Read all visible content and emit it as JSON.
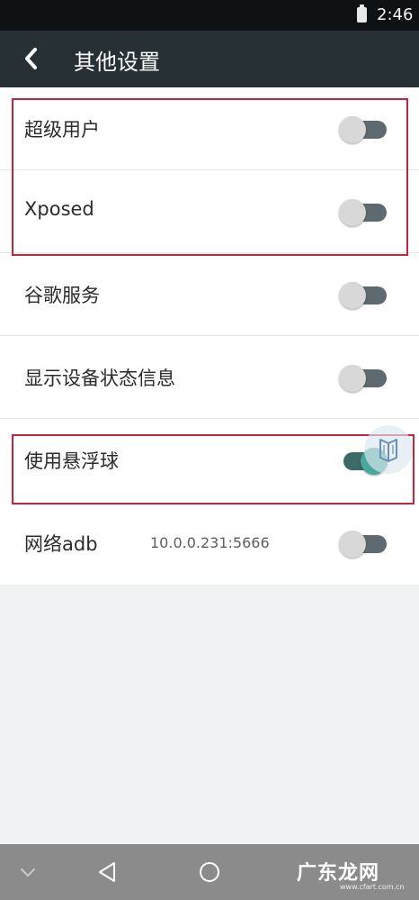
{
  "status_bar": {
    "time": "2:46"
  },
  "app_bar": {
    "title": "其他设置"
  },
  "settings": [
    {
      "label": "超级用户",
      "enabled": false
    },
    {
      "label": "Xposed",
      "enabled": false
    },
    {
      "label": "谷歌服务",
      "enabled": false
    },
    {
      "label": "显示设备状态信息",
      "enabled": false
    },
    {
      "label": "使用悬浮球",
      "enabled": true
    },
    {
      "label": "网络adb",
      "value": "10.0.0.231:5666",
      "enabled": false
    }
  ],
  "highlight_color": "#c6243b",
  "toggle_on_color": "#4aa79b",
  "watermark": {
    "text": "广东龙网",
    "url": "www.cfart.com.cn"
  }
}
